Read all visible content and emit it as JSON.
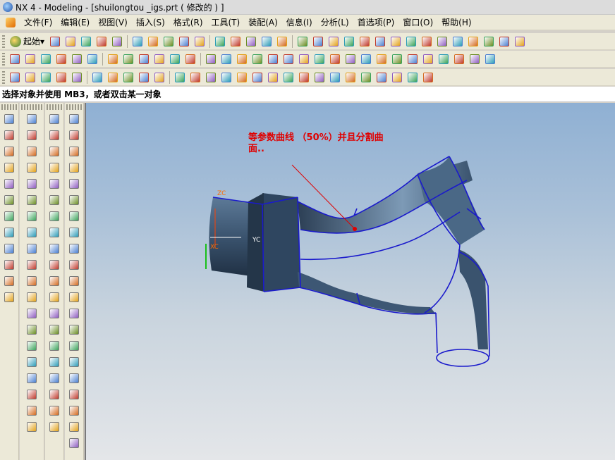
{
  "titlebar": {
    "title": "NX 4 - Modeling - [shuilongtou _igs.prt ( 修改的 ) ]"
  },
  "menubar": {
    "items": [
      "文件(F)",
      "编辑(E)",
      "视图(V)",
      "插入(S)",
      "格式(R)",
      "工具(T)",
      "装配(A)",
      "信息(I)",
      "分析(L)",
      "首选项(P)",
      "窗口(O)",
      "帮助(H)"
    ]
  },
  "toolbar": {
    "start_label": "起始",
    "icons_row1": [
      "new-icon",
      "open-icon",
      "save-icon",
      "cut-icon",
      "copy-icon",
      "paste-icon",
      "delete-icon",
      "undo-icon",
      "edit-icon",
      "select-icon",
      "fit-icon",
      "zoom-icon",
      "rotate-icon",
      "pan-icon",
      "shaded-icon",
      "view-orient-icon",
      "layer-icon",
      "light-icon",
      "snap-icon",
      "wave-icon"
    ],
    "icons_row2": [
      "sketch-icon",
      "curve-icon",
      "spline-icon",
      "offset-icon",
      "bridge-icon",
      "project-icon",
      "trim-icon",
      "extrude-icon",
      "revolve-icon",
      "sweep-icon",
      "surface-icon",
      "blend-icon",
      "chamfer-icon",
      "analyze-icon",
      "section-icon",
      "measure-icon",
      "select-mode-icon"
    ],
    "icons_row3": [
      "line-icon",
      "arc-icon",
      "circle-icon",
      "spline-curve-icon",
      "point-icon",
      "rectangle-icon",
      "polygon-icon",
      "ellipse-icon",
      "helix-icon",
      "curve-edit-icon",
      "trim-curve-icon",
      "divide-curve-icon",
      "join-icon",
      "offset-curve-icon",
      "isoparametric-icon"
    ]
  },
  "prompt": {
    "text": "选择对象并使用 MB3，或者双击某一对象"
  },
  "viewport": {
    "annotation_line1": "等参数曲线 （50%）并且分割曲",
    "annotation_line2": "面..",
    "axis_zc": "ZC",
    "axis_xc": "XC",
    "axis_yc": "YC"
  },
  "colors": {
    "annotation": "#e00000",
    "wireframe": "#1a1acc",
    "background_top": "#8fb0d3",
    "background_bottom": "#e4e6e9"
  }
}
